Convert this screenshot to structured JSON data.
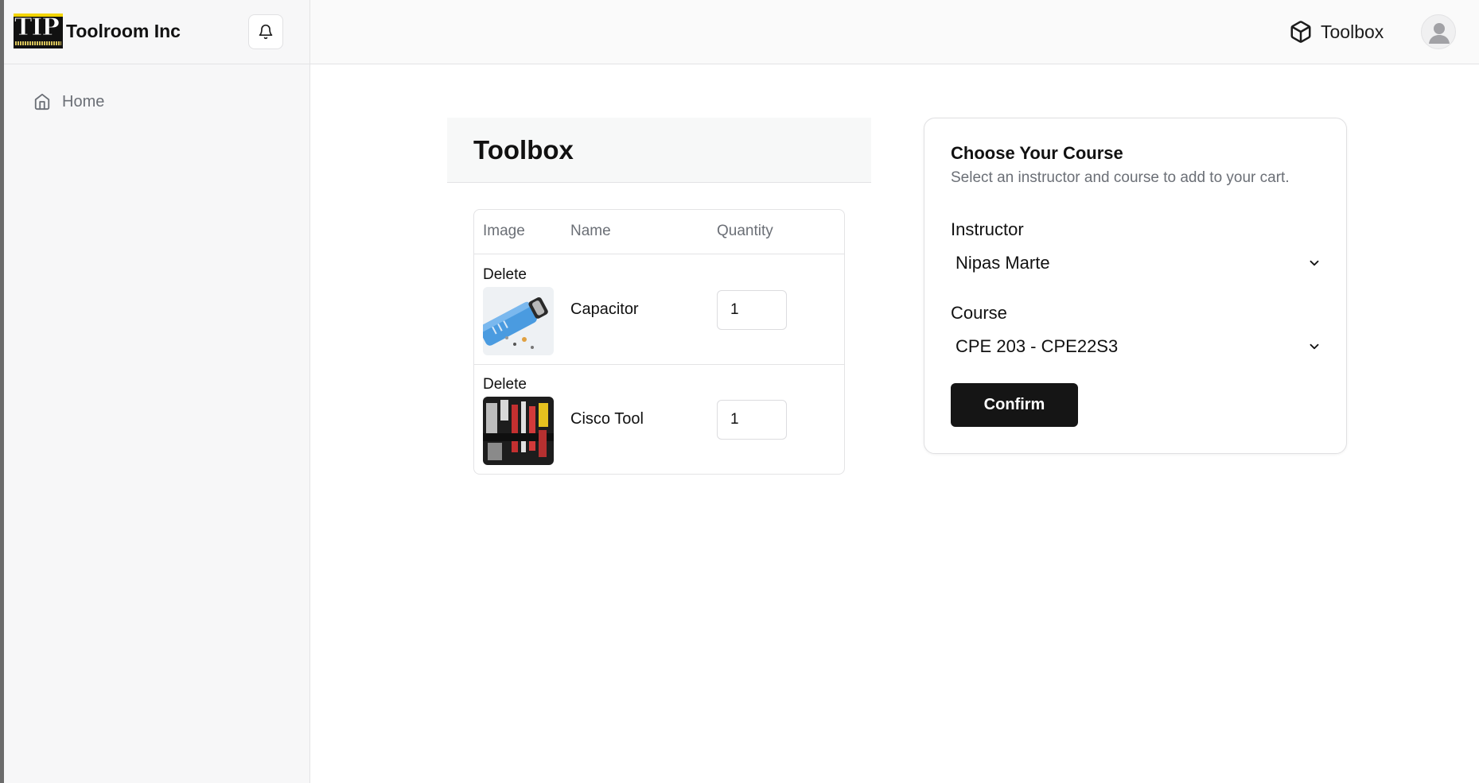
{
  "app": {
    "brand_logo_text": "TIP",
    "brand_name": "Toolroom Inc"
  },
  "sidebar": {
    "items": [
      {
        "label": "Home",
        "icon": "home-icon"
      }
    ]
  },
  "topbar": {
    "toolbox_label": "Toolbox",
    "toolbox_icon": "cube-icon",
    "notification_icon": "bell-icon",
    "avatar_icon": "user-avatar-icon"
  },
  "toolbox": {
    "title": "Toolbox",
    "columns": [
      "Image",
      "Name",
      "Quantity"
    ],
    "items": [
      {
        "delete_label": "Delete",
        "name": "Capacitor",
        "quantity": "1",
        "image": "capacitor-thumbnail"
      },
      {
        "delete_label": "Delete",
        "name": "Cisco Tool",
        "quantity": "1",
        "image": "cisco-tool-thumbnail"
      }
    ]
  },
  "course_form": {
    "title": "Choose Your Course",
    "subtitle": "Select an instructor and course to add to your cart.",
    "instructor_label": "Instructor",
    "instructor_value": "Nipas Marte",
    "course_label": "Course",
    "course_value": "CPE 203 - CPE22S3",
    "confirm_label": "Confirm"
  },
  "colors": {
    "accent": "#151515",
    "muted_text": "#6b6f76",
    "border": "#e3e3e5",
    "logo_yellow": "#f2d400"
  }
}
